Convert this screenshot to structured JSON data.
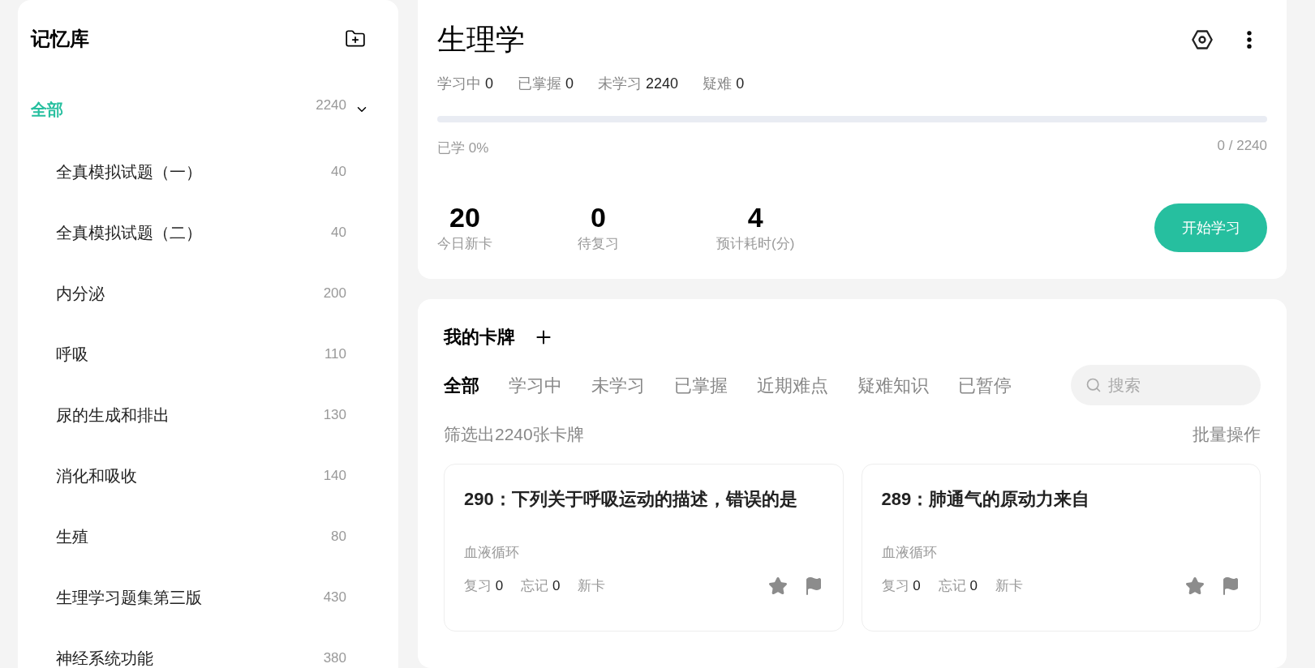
{
  "sidebar": {
    "title": "记忆库",
    "root": {
      "label": "全部",
      "count": "2240",
      "selected": true,
      "expanded": true
    },
    "items": [
      {
        "label": "全真模拟试题（一）",
        "count": "40",
        "selected": false
      },
      {
        "label": "全真模拟试题（二）",
        "count": "40",
        "selected": false
      },
      {
        "label": "内分泌",
        "count": "200",
        "selected": false
      },
      {
        "label": "呼吸",
        "count": "110",
        "selected": false
      },
      {
        "label": "尿的生成和排出",
        "count": "130",
        "selected": false
      },
      {
        "label": "消化和吸收",
        "count": "140",
        "selected": false
      },
      {
        "label": "生殖",
        "count": "80",
        "selected": false
      },
      {
        "label": "生理学习题集第三版",
        "count": "430",
        "selected": false
      },
      {
        "label": "神经系统功能",
        "count": "380",
        "selected": false
      }
    ]
  },
  "deck": {
    "title": "生理学",
    "stats": [
      {
        "label": "学习中",
        "value": "0"
      },
      {
        "label": "已掌握",
        "value": "0"
      },
      {
        "label": "未学习",
        "value": "2240"
      },
      {
        "label": "疑难",
        "value": "0"
      }
    ],
    "progress": {
      "level": 0,
      "label": "已学 0%",
      "reading": "0 / 2240"
    },
    "metrics": [
      {
        "value": "20",
        "label": "今日新卡"
      },
      {
        "value": "0",
        "label": "待复习"
      },
      {
        "value": "4",
        "label": "预计耗时(分)"
      }
    ],
    "start_button": "开始学习"
  },
  "cards_panel": {
    "title": "我的卡牌",
    "tabs": [
      {
        "label": "全部",
        "selected": true
      },
      {
        "label": "学习中",
        "selected": false
      },
      {
        "label": "未学习",
        "selected": false
      },
      {
        "label": "已掌握",
        "selected": false
      },
      {
        "label": "近期难点",
        "selected": false
      },
      {
        "label": "疑难知识",
        "selected": false
      },
      {
        "label": "已暂停",
        "selected": false
      }
    ],
    "search": {
      "placeholder": "搜索"
    },
    "filter_summary": "筛选出2240张卡牌",
    "bulk_action": "批量操作",
    "cards": [
      {
        "title": "290：下列关于呼吸运动的描述，错误的是",
        "category": "血液循环",
        "review_label": "复习",
        "review": "0",
        "forget_label": "忘记",
        "forget": "0",
        "status": "新卡"
      },
      {
        "title": "289：肺通气的原动力来自",
        "category": "血液循环",
        "review_label": "复习",
        "review": "0",
        "forget_label": "忘记",
        "forget": "0",
        "status": "新卡"
      }
    ]
  }
}
